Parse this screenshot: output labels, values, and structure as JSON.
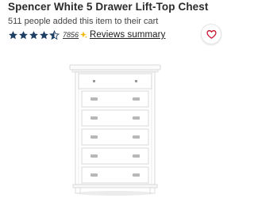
{
  "product": {
    "title": "Spencer White 5 Drawer Lift-Top Chest",
    "cart_note": "511 people added this item to their cart",
    "rating": 4.5,
    "review_count": "7856",
    "reviews_link": "Reviews summary",
    "image_alt": "white five drawer lift-top chest"
  },
  "icons": {
    "star": "star-icon",
    "sparkle": "sparkle-icon",
    "wishlist": "heart-icon"
  },
  "colors": {
    "star": "#1f3f64",
    "heart": "#c8102e",
    "sparkle": "#f2b600",
    "furniture": "#ffffff"
  }
}
